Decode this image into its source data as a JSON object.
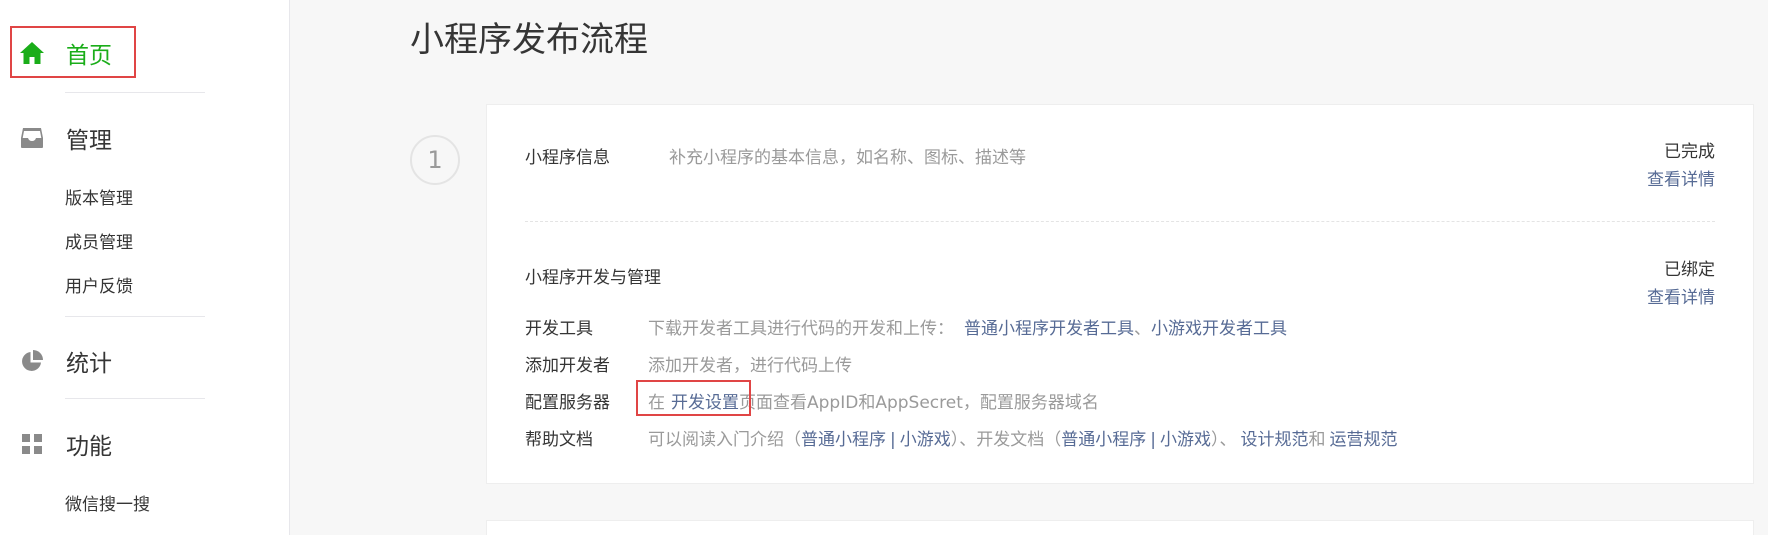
{
  "sidebar": {
    "home": {
      "label": "首页",
      "icon": "home-icon"
    },
    "manage": {
      "label": "管理",
      "icon": "inbox-icon",
      "items": [
        "版本管理",
        "成员管理",
        "用户反馈"
      ]
    },
    "stats": {
      "label": "统计",
      "icon": "pie-chart-icon"
    },
    "features": {
      "label": "功能",
      "icon": "grid-icon",
      "items": [
        "微信搜一搜"
      ]
    }
  },
  "main": {
    "title": "小程序发布流程",
    "step_number": "1",
    "info": {
      "title": "小程序信息",
      "desc": "补充小程序的基本信息，如名称、图标、描述等",
      "status": "已完成",
      "detail": "查看详情"
    },
    "dev": {
      "title": "小程序开发与管理",
      "status": "已绑定",
      "detail": "查看详情",
      "rows": {
        "tools": {
          "label": "开发工具",
          "desc": "下载开发者工具进行代码的开发和上传：",
          "link1": "普通小程序开发者工具",
          "sep": "、",
          "link2": "小游戏开发者工具"
        },
        "add_dev": {
          "label": "添加开发者",
          "desc": "添加开发者，进行代码上传"
        },
        "server": {
          "label": "配置服务器",
          "prefix": "在",
          "link": "开发设置",
          "suffix": "页面查看AppID和AppSecret，配置服务器域名"
        },
        "help": {
          "label": "帮助文档",
          "intro": "可以阅读入门介绍（",
          "link1": "普通小程序",
          "bar1": "|",
          "link2": "小游戏",
          "mid": "）、开发文档（",
          "link3": "普通小程序",
          "bar2": "|",
          "link4": "小游戏",
          "end": "）、",
          "link5": "设计规范",
          "and": "和",
          "link6": "运营规范"
        }
      }
    }
  },
  "colors": {
    "accent_green": "#1aad19",
    "link_blue": "#576b95",
    "highlight_red": "#e04545"
  }
}
